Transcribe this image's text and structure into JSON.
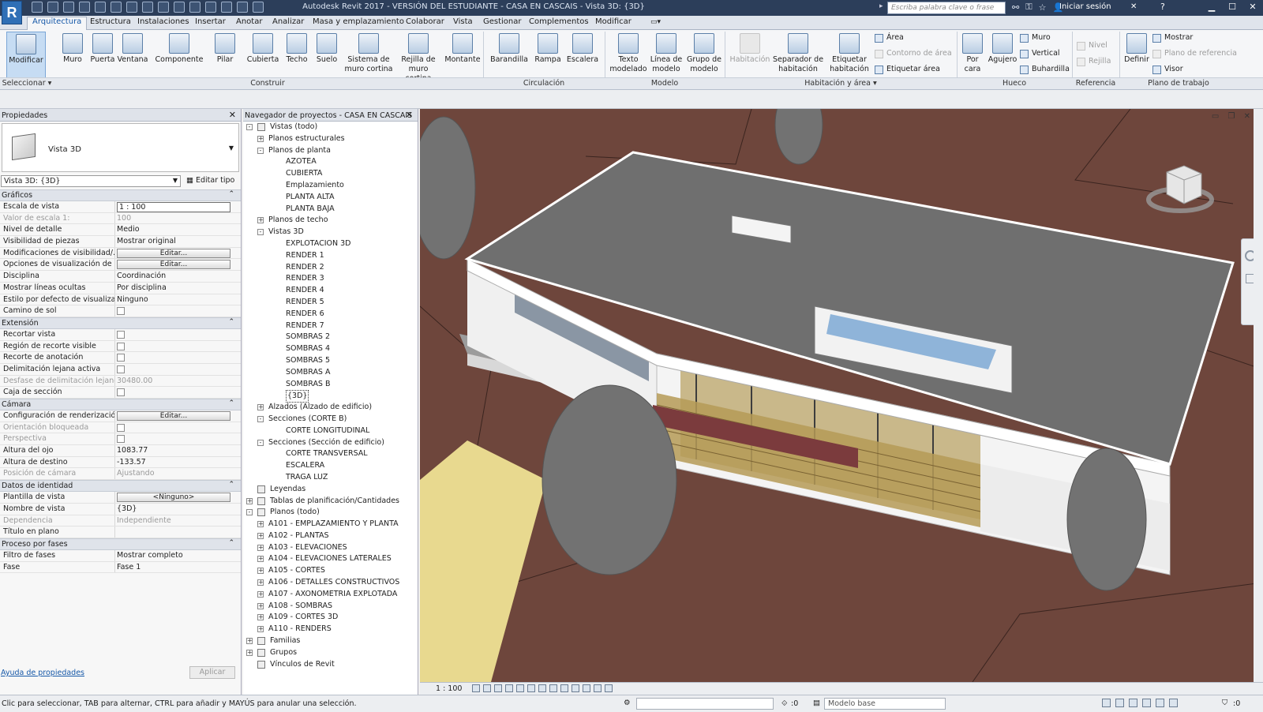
{
  "app": {
    "logo": "R",
    "title": "Autodesk Revit 2017 - VERSIÓN DEL ESTUDIANTE -   CASA EN CASCAIS - Vista 3D: {3D}"
  },
  "titlebar": {
    "search_placeholder": "Escriba palabra clave o frase",
    "login": "Iniciar sesión"
  },
  "tabs": [
    "Arquitectura",
    "Estructura",
    "Instalaciones",
    "Insertar",
    "Anotar",
    "Analizar",
    "Masa y emplazamiento",
    "Colaborar",
    "Vista",
    "Gestionar",
    "Complementos",
    "Modificar"
  ],
  "ribbon": {
    "buttons": [
      {
        "id": "modificar",
        "label": "Modificar",
        "icon": "cursor-icon"
      },
      {
        "id": "muro",
        "label": "Muro",
        "icon": "wall-icon"
      },
      {
        "id": "puerta",
        "label": "Puerta",
        "icon": "door-icon"
      },
      {
        "id": "ventana",
        "label": "Ventana",
        "icon": "window-icon"
      },
      {
        "id": "componente",
        "label": "Componente",
        "icon": "component-icon"
      },
      {
        "id": "pilar",
        "label": "Pilar",
        "icon": "column-icon"
      },
      {
        "id": "cubierta",
        "label": "Cubierta",
        "icon": "roof-icon"
      },
      {
        "id": "techo",
        "label": "Techo",
        "icon": "ceiling-icon"
      },
      {
        "id": "suelo",
        "label": "Suelo",
        "icon": "floor-icon"
      },
      {
        "id": "sistema",
        "label": "Sistema de muro cortina",
        "icon": "curtain-system-icon"
      },
      {
        "id": "rejilla",
        "label": "Rejilla de muro cortina",
        "icon": "curtain-grid-icon"
      },
      {
        "id": "montante",
        "label": "Montante",
        "icon": "mullion-icon"
      },
      {
        "id": "barandilla",
        "label": "Barandilla",
        "icon": "railing-icon"
      },
      {
        "id": "rampa",
        "label": "Rampa",
        "icon": "ramp-icon"
      },
      {
        "id": "escalera",
        "label": "Escalera",
        "icon": "stair-icon"
      },
      {
        "id": "texto",
        "label": "Texto modelado",
        "icon": "model-text-icon"
      },
      {
        "id": "linea",
        "label": "Línea de modelo",
        "icon": "model-line-icon"
      },
      {
        "id": "grupo",
        "label": "Grupo de modelo",
        "icon": "model-group-icon"
      },
      {
        "id": "habitacion",
        "label": "Habitación",
        "icon": "room-icon"
      },
      {
        "id": "separador",
        "label": "Separador de habitación",
        "icon": "room-separator-icon"
      },
      {
        "id": "etiquetar",
        "label": "Etiquetar habitación",
        "icon": "tag-room-icon"
      },
      {
        "id": "porcara",
        "label": "Por cara",
        "icon": "by-face-icon"
      },
      {
        "id": "agujero",
        "label": "Agujero",
        "icon": "shaft-icon"
      },
      {
        "id": "definir",
        "label": "Definir",
        "icon": "set-workplane-icon"
      }
    ],
    "small": {
      "area": "Área",
      "contorno": "Contorno  de área",
      "etiquetar_area": "Etiquetar  área",
      "muro": "Muro",
      "vertical": "Vertical",
      "buhardilla": "Buhardilla",
      "nivel": "Nivel",
      "rejilla": "Rejilla",
      "mostrar": "Mostrar",
      "plano_ref": "Plano de referencia",
      "visor": "Visor"
    },
    "panels": [
      "Seleccionar ▾",
      "Construir",
      "Circulación",
      "Modelo",
      "Habitación y área ▾",
      "Hueco",
      "Referencia",
      "Plano de trabajo"
    ]
  },
  "properties": {
    "title": "Propiedades",
    "type_name": "Vista 3D",
    "instance": "Vista 3D: {3D}",
    "edit_type": "Editar tipo",
    "groups": [
      {
        "name": "Gráficos",
        "rows": [
          {
            "k": "Escala de vista",
            "v": "1 : 100",
            "kind": "input"
          },
          {
            "k": "Valor de escala    1:",
            "v": "100",
            "kind": "dis"
          },
          {
            "k": "Nivel de detalle",
            "v": "Medio"
          },
          {
            "k": "Visibilidad de piezas",
            "v": "Mostrar original"
          },
          {
            "k": "Modificaciones de visibilidad/...",
            "v": "Editar...",
            "kind": "btn"
          },
          {
            "k": "Opciones de visualización de ...",
            "v": "Editar...",
            "kind": "btn"
          },
          {
            "k": "Disciplina",
            "v": "Coordinación"
          },
          {
            "k": "Mostrar líneas ocultas",
            "v": "Por disciplina"
          },
          {
            "k": "Estilo por defecto de visualizac...",
            "v": "Ninguno"
          },
          {
            "k": "Camino de sol",
            "v": "",
            "kind": "cb"
          }
        ]
      },
      {
        "name": "Extensión",
        "rows": [
          {
            "k": "Recortar vista",
            "v": "",
            "kind": "cb"
          },
          {
            "k": "Región de recorte visible",
            "v": "",
            "kind": "cb"
          },
          {
            "k": "Recorte de anotación",
            "v": "",
            "kind": "cb"
          },
          {
            "k": "Delimitación lejana activa",
            "v": "",
            "kind": "cb"
          },
          {
            "k": "Desfase de delimitación lejano",
            "v": "30480.00",
            "kind": "dis"
          },
          {
            "k": "Caja de sección",
            "v": "",
            "kind": "cb"
          }
        ]
      },
      {
        "name": "Cámara",
        "rows": [
          {
            "k": "Configuración de renderización",
            "v": "Editar...",
            "kind": "btn"
          },
          {
            "k": "Orientación bloqueada",
            "v": "",
            "kind": "cbdis"
          },
          {
            "k": "Perspectiva",
            "v": "",
            "kind": "cbdis"
          },
          {
            "k": "Altura del ojo",
            "v": "1083.77"
          },
          {
            "k": "Altura de destino",
            "v": "-133.57"
          },
          {
            "k": "Posición de cámara",
            "v": "Ajustando",
            "kind": "dis"
          }
        ]
      },
      {
        "name": "Datos de identidad",
        "rows": [
          {
            "k": "Plantilla de vista",
            "v": "<Ninguno>",
            "kind": "btn"
          },
          {
            "k": "Nombre de vista",
            "v": "{3D}"
          },
          {
            "k": "Dependencia",
            "v": "Independiente",
            "kind": "dis"
          },
          {
            "k": "Título en plano",
            "v": ""
          }
        ]
      },
      {
        "name": "Proceso por fases",
        "rows": [
          {
            "k": "Filtro de fases",
            "v": "Mostrar completo"
          },
          {
            "k": "Fase",
            "v": "Fase 1"
          }
        ]
      }
    ],
    "help_link": "Ayuda de propiedades",
    "apply": "Aplicar"
  },
  "browser": {
    "title": "Navegador de proyectos - CASA EN CASCAIS",
    "nodes": [
      {
        "t": "Vistas (todo)",
        "l": 0,
        "tg": "-",
        "ic": true
      },
      {
        "t": "Planos estructurales",
        "l": 1,
        "tg": "+"
      },
      {
        "t": "Planos de planta",
        "l": 1,
        "tg": "-"
      },
      {
        "t": "AZOTEA",
        "l": 2
      },
      {
        "t": "CUBIERTA",
        "l": 2
      },
      {
        "t": "Emplazamiento",
        "l": 2
      },
      {
        "t": "PLANTA ALTA",
        "l": 2
      },
      {
        "t": "PLANTA BAJA",
        "l": 2
      },
      {
        "t": "Planos de techo",
        "l": 1,
        "tg": "+"
      },
      {
        "t": "Vistas 3D",
        "l": 1,
        "tg": "-"
      },
      {
        "t": "EXPLOTACION 3D",
        "l": 2
      },
      {
        "t": "RENDER 1",
        "l": 2
      },
      {
        "t": "RENDER 2",
        "l": 2
      },
      {
        "t": "RENDER 3",
        "l": 2
      },
      {
        "t": "RENDER 4",
        "l": 2
      },
      {
        "t": "RENDER 5",
        "l": 2
      },
      {
        "t": "RENDER 6",
        "l": 2
      },
      {
        "t": "RENDER 7",
        "l": 2
      },
      {
        "t": "SOMBRAS 2",
        "l": 2
      },
      {
        "t": "SOMBRAS 4",
        "l": 2
      },
      {
        "t": "SOMBRAS 5",
        "l": 2
      },
      {
        "t": "SOMBRAS A",
        "l": 2
      },
      {
        "t": "SOMBRAS B",
        "l": 2
      },
      {
        "t": "{3D}",
        "l": 2,
        "sel": true
      },
      {
        "t": "Alzados (Alzado de edificio)",
        "l": 1,
        "tg": "+"
      },
      {
        "t": "Secciones (CORTE B)",
        "l": 1,
        "tg": "-"
      },
      {
        "t": "CORTE LONGITUDINAL",
        "l": 2
      },
      {
        "t": "Secciones (Sección de edificio)",
        "l": 1,
        "tg": "-"
      },
      {
        "t": "CORTE TRANSVERSAL",
        "l": 2
      },
      {
        "t": "ESCALERA",
        "l": 2
      },
      {
        "t": "TRAGA LUZ",
        "l": 2
      },
      {
        "t": "Leyendas",
        "l": 0,
        "ic": true
      },
      {
        "t": "Tablas de planificación/Cantidades",
        "l": 0,
        "tg": "+",
        "ic": true
      },
      {
        "t": "Planos (todo)",
        "l": 0,
        "tg": "-",
        "ic": true
      },
      {
        "t": "A101 - EMPLAZAMIENTO Y PLANTA",
        "l": 1,
        "tg": "+"
      },
      {
        "t": "A102 - PLANTAS",
        "l": 1,
        "tg": "+"
      },
      {
        "t": "A103 - ELEVACIONES",
        "l": 1,
        "tg": "+"
      },
      {
        "t": "A104 - ELEVACIONES LATERALES",
        "l": 1,
        "tg": "+"
      },
      {
        "t": "A105 - CORTES",
        "l": 1,
        "tg": "+"
      },
      {
        "t": "A106 - DETALLES CONSTRUCTIVOS",
        "l": 1,
        "tg": "+"
      },
      {
        "t": "A107 - AXONOMETRIA EXPLOTADA",
        "l": 1,
        "tg": "+"
      },
      {
        "t": "A108 - SOMBRAS",
        "l": 1,
        "tg": "+"
      },
      {
        "t": "A109 - CORTES 3D",
        "l": 1,
        "tg": "+"
      },
      {
        "t": "A110 - RENDERS",
        "l": 1,
        "tg": "+"
      },
      {
        "t": "Familias",
        "l": 0,
        "tg": "+",
        "ic": true
      },
      {
        "t": "Grupos",
        "l": 0,
        "tg": "+",
        "ic": true
      },
      {
        "t": "Vínculos de Revit",
        "l": 0,
        "ic": true
      }
    ]
  },
  "viewbar": {
    "scale": "1 : 100"
  },
  "status": {
    "message": "Clic para seleccionar, TAB para alternar, CTRL para añadir y MAYÚS para anular una selección.",
    "zero": ":0",
    "model": "Modelo base",
    "zero2": ":0"
  },
  "colors": {
    "ground": "#6e463c",
    "roof": "#6e6e6e",
    "wall": "#f2f2f2",
    "accent": "#2f6fb6"
  }
}
